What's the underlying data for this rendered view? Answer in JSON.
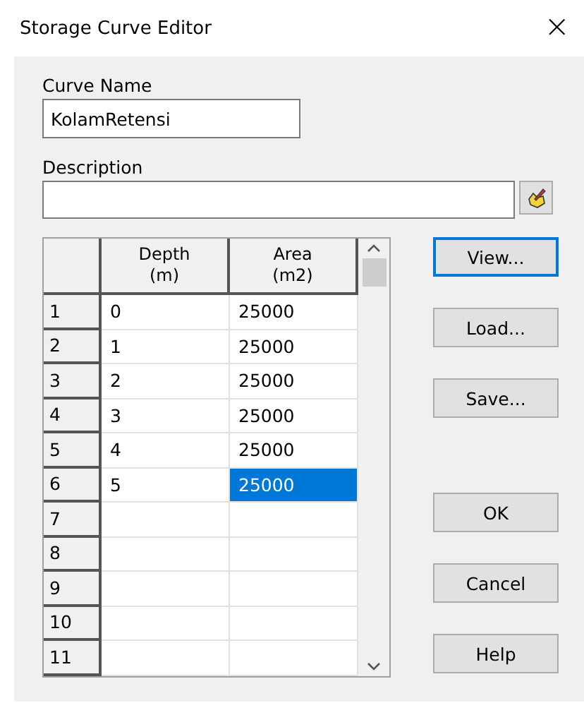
{
  "window": {
    "title": "Storage Curve Editor",
    "close": "×"
  },
  "curve_name": {
    "label": "Curve Name",
    "value": "KolamRetensi"
  },
  "description": {
    "label": "Description"
  },
  "table": {
    "columns": [
      {
        "line1": "Depth",
        "line2": "(m)"
      },
      {
        "line1": "Area",
        "line2": "(m2)"
      }
    ],
    "rows": [
      {
        "label": "1",
        "cells": [
          {
            "text": "0",
            "selected": false
          },
          {
            "text": "25000",
            "selected": false
          }
        ]
      },
      {
        "label": "2",
        "cells": [
          {
            "text": "1",
            "selected": false
          },
          {
            "text": "25000",
            "selected": false
          }
        ]
      },
      {
        "label": "3",
        "cells": [
          {
            "text": "2",
            "selected": false
          },
          {
            "text": "25000",
            "selected": false
          }
        ]
      },
      {
        "label": "4",
        "cells": [
          {
            "text": "3",
            "selected": false
          },
          {
            "text": "25000",
            "selected": false
          }
        ]
      },
      {
        "label": "5",
        "cells": [
          {
            "text": "4",
            "selected": false
          },
          {
            "text": "25000",
            "selected": false
          }
        ]
      },
      {
        "label": "6",
        "cells": [
          {
            "text": "5",
            "selected": false
          },
          {
            "text": "25000",
            "selected": true
          }
        ]
      },
      {
        "label": "7",
        "cells": [
          {
            "selected": false
          },
          {
            "selected": false
          }
        ]
      },
      {
        "label": "8",
        "cells": [
          {
            "selected": false
          },
          {
            "selected": false
          }
        ]
      },
      {
        "label": "9",
        "cells": [
          {
            "selected": false
          },
          {
            "selected": false
          }
        ]
      },
      {
        "label": "10",
        "cells": [
          {
            "selected": false
          },
          {
            "selected": false
          }
        ]
      },
      {
        "label": "11",
        "cells": [
          {
            "selected": false
          },
          {
            "selected": false
          }
        ]
      }
    ]
  },
  "file_buttons": [
    {
      "label": "View...",
      "focused": true
    },
    {
      "label": "Load...",
      "focused": false
    },
    {
      "label": "Save...",
      "focused": false
    }
  ],
  "dialog_buttons": [
    {
      "label": "OK",
      "focused": false
    },
    {
      "label": "Cancel",
      "focused": false
    },
    {
      "label": "Help",
      "focused": false
    }
  ]
}
